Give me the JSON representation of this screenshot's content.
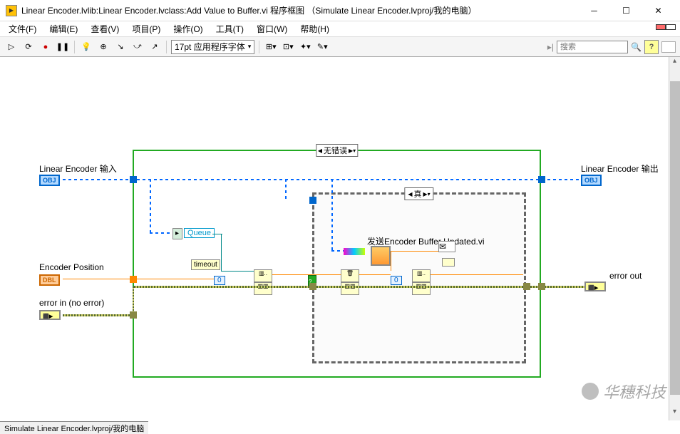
{
  "window": {
    "title": "Linear Encoder.lvlib:Linear Encoder.lvclass:Add Value to Buffer.vi 程序框图 （Simulate Linear Encoder.lvproj/我的电脑）",
    "min": "─",
    "max": "☐",
    "close": "✕"
  },
  "menu": {
    "file": "文件(F)",
    "edit": "编辑(E)",
    "view": "查看(V)",
    "project": "项目(P)",
    "operate": "操作(O)",
    "tools": "工具(T)",
    "window": "窗口(W)",
    "help": "帮助(H)"
  },
  "toolbar": {
    "run": "▷",
    "runcont": "⟳",
    "abort": "●",
    "pause": "❚❚",
    "hilite": "💡",
    "retain": "⊕",
    "step_into": "↘",
    "step_over": "⤻",
    "step_out": "↗",
    "font": "17pt 应用程序字体",
    "align": "⊞▾",
    "distrib": "⊡▾",
    "resize": "✦▾",
    "reorder": "✎▾",
    "search_placeholder": "搜索",
    "search_icon": "🔍",
    "help_icon": "?"
  },
  "diagram": {
    "input_obj": "Linear Encoder 输入",
    "output_obj": "Linear Encoder 输出",
    "encoder_pos": "Encoder Position",
    "error_in": "error in (no error)",
    "error_out": "error out",
    "case_outer": "无错误",
    "case_inner": "真",
    "queue": "Queue",
    "timeout": "timeout",
    "subvi": "发送Encoder Buffer Updated.vi",
    "const0a": "0",
    "const0b": "0",
    "obj_tag": "OBJ",
    "dbl_tag": "DBL"
  },
  "status": {
    "path": "Simulate Linear Encoder.lvproj/我的电脑"
  },
  "watermark": "华穗科技"
}
